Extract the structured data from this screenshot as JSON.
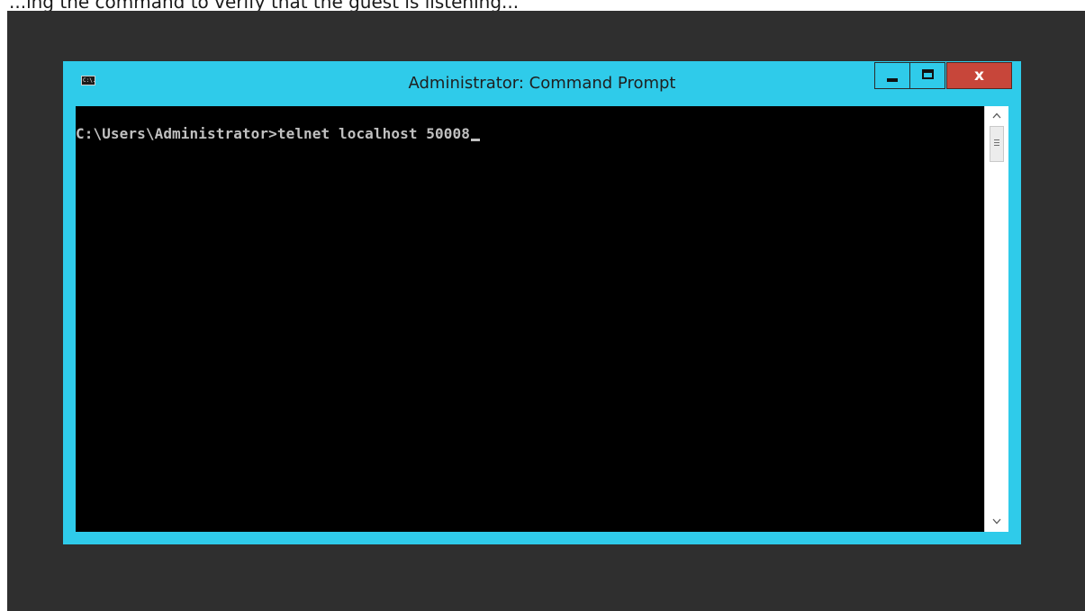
{
  "caption": {
    "text": "...ing the command to verify that the guest is listening..."
  },
  "window": {
    "title": "Administrator: Command Prompt",
    "icon": "cmd-icon",
    "icon_label": "C:\\.",
    "buttons": {
      "minimize": "minimize-icon",
      "maximize": "maximize-icon",
      "close": "x"
    },
    "accent_color": "#2fcbea",
    "close_color": "#c7463a"
  },
  "console": {
    "line": "C:\\Users\\Administrator>telnet localhost 50008",
    "background": "#000000",
    "text_color": "#c0c0c0"
  },
  "scrollbar": {
    "up_arrow": "^",
    "down_arrow": "v"
  }
}
